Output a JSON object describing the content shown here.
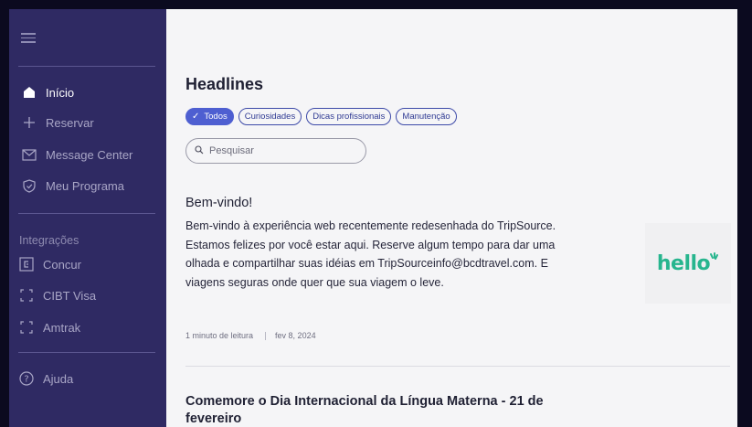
{
  "sidebar": {
    "items": [
      {
        "label": "Início",
        "icon": "home-icon"
      },
      {
        "label": "Reservar",
        "icon": "plus-icon"
      },
      {
        "label": "Message Center",
        "icon": "mail-icon"
      },
      {
        "label": "Meu Programa",
        "icon": "shield-icon"
      }
    ],
    "integrations_label": "Integrações",
    "integrations": [
      {
        "label": "Concur",
        "icon": "concur-icon"
      },
      {
        "label": "CIBT Visa",
        "icon": "external-bracket-icon"
      },
      {
        "label": "Amtrak",
        "icon": "external-bracket-icon"
      }
    ],
    "help_label": "Ajuda"
  },
  "main": {
    "title": "Headlines",
    "filters": [
      "Todos",
      "Curiosidades",
      "Dicas profissionais",
      "Manutenção"
    ],
    "search_placeholder": "Pesquisar",
    "articles": [
      {
        "title": "Bem-vindo!",
        "body": "Bem-vindo à experiência web recentemente redesenhada do TripSource. Estamos felizes por você estar aqui. Reserve algum tempo para dar uma olhada e compartilhar suas idéias em TripSourceinfo@bcdtravel.com. E viagens seguras onde quer que sua viagem o leve.",
        "read_time": "1 minuto de leitura",
        "date": "fev 8, 2024",
        "image_text": "hello"
      },
      {
        "title": "Comemore o Dia Internacional da Língua Materna - 21 de fevereiro"
      }
    ]
  },
  "colors": {
    "sidebar_bg": "#2f2a63",
    "accent": "#4e5fd1",
    "hello_green": "#27b58e"
  }
}
